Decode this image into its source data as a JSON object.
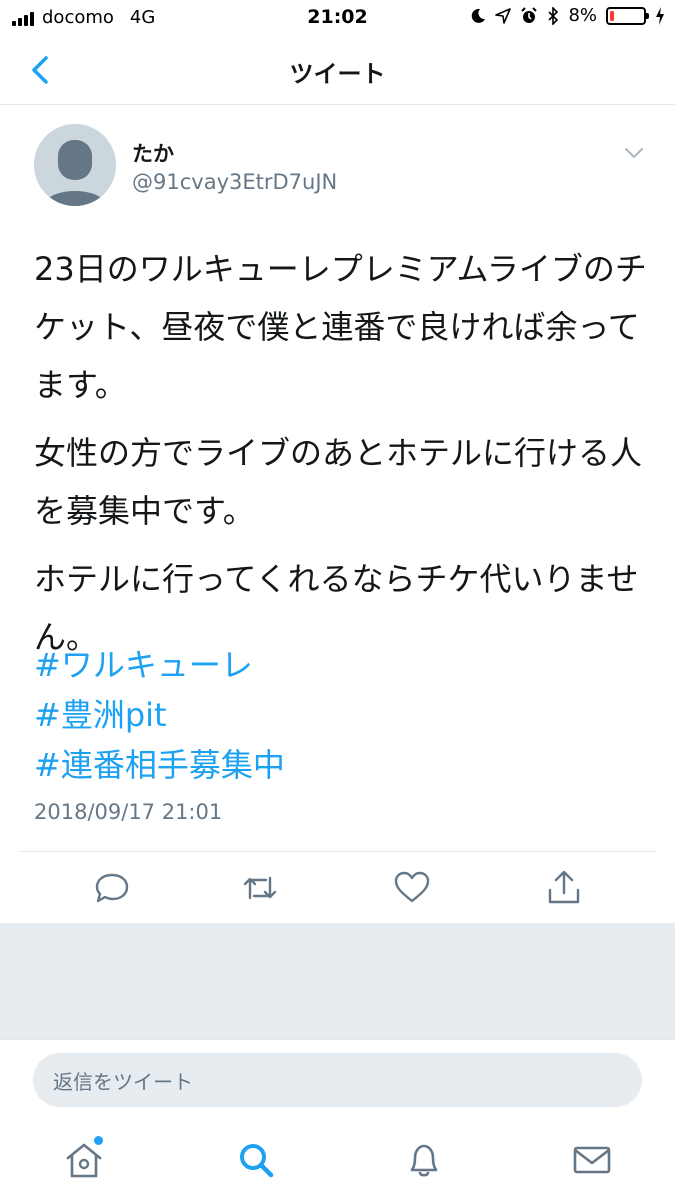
{
  "status_bar": {
    "carrier": "docomo",
    "network": "4G",
    "time": "21:02",
    "battery": "8%",
    "icons": [
      "moon-icon",
      "location-icon",
      "alarm-icon",
      "bluetooth-icon",
      "charging-icon"
    ],
    "battery_level": 0.08,
    "battery_color": "#ff3b30"
  },
  "nav": {
    "title": "ツイート",
    "back_icon": "chevron-left-icon"
  },
  "tweet": {
    "display_name": "たか",
    "handle": "@91cvay3EtrD7uJN",
    "body": [
      "23日のワルキューレプレミアムライブのチケット、昼夜で僕と連番で良ければ余ってます。",
      "女性の方でライブのあとホテルに行ける人を募集中です。",
      "ホテルに行ってくれるならチケ代いりません。"
    ],
    "hashtags": [
      "#ワルキューレ",
      "#豊洲pit",
      "#連番相手募集中"
    ],
    "timestamp": "2018/09/17 21:01"
  },
  "actions": [
    "reply-icon",
    "retweet-icon",
    "like-icon",
    "share-icon"
  ],
  "reply": {
    "placeholder": "返信をツイート"
  },
  "tabs": [
    "home-icon",
    "search-icon",
    "notifications-icon",
    "messages-icon"
  ],
  "colors": {
    "accent": "#1da1f2",
    "secondary_text": "#657786",
    "divider": "#e1e8ed",
    "background_gray": "#e6ecf0"
  }
}
